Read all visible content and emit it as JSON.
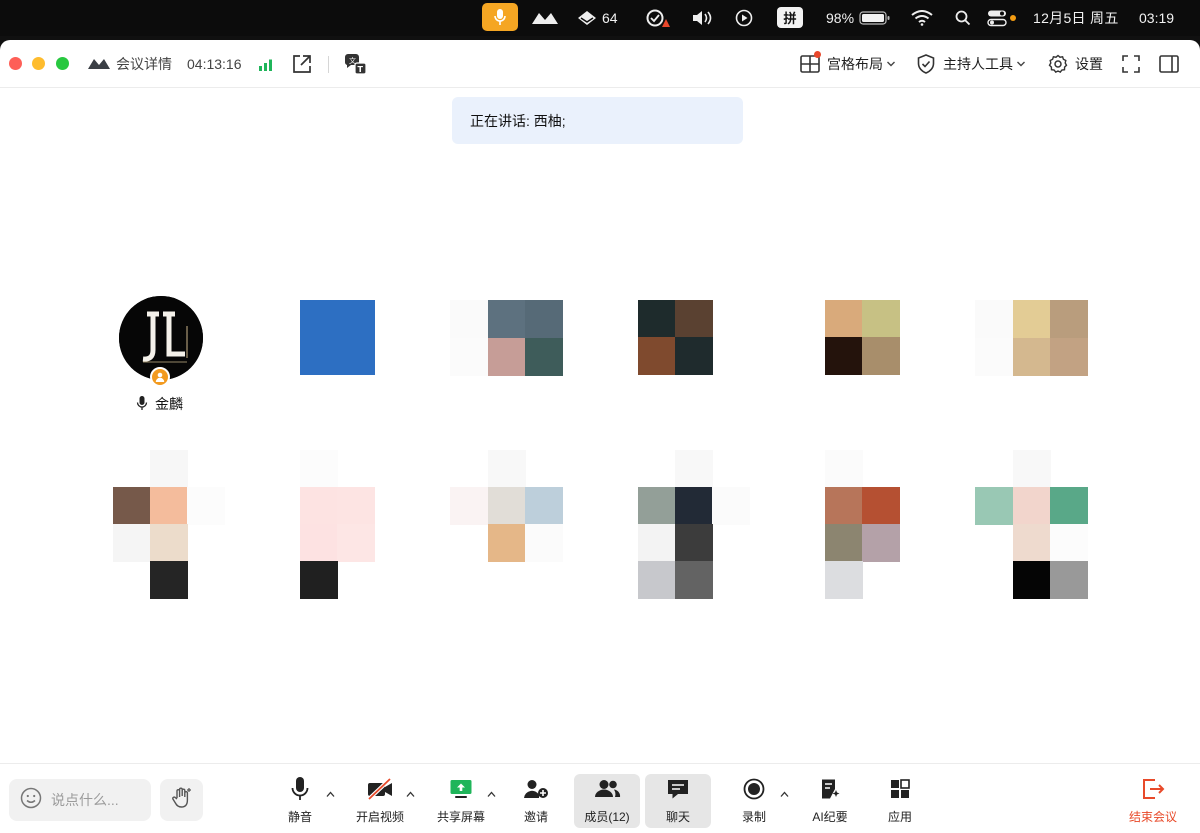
{
  "menubar": {
    "ime": "拼",
    "notify_count": "64",
    "battery": "98%",
    "date": "12月5日 周五",
    "time": "03:19"
  },
  "titlebar": {
    "meeting_details": "会议详情",
    "elapsed": "04:13:16",
    "layout": "宫格布局",
    "host_tools": "主持人工具",
    "settings": "设置"
  },
  "speaking": "正在讲话: 西柚;",
  "participants": [
    {
      "name": "金麟",
      "role": "host",
      "avatar_initials": "JL"
    }
  ],
  "chat": {
    "placeholder": "说点什么..."
  },
  "toolbar": {
    "mute": "静音",
    "video": "开启视频",
    "share": "共享屏幕",
    "invite": "邀请",
    "members": "成员(12)",
    "chat": "聊天",
    "record": "录制",
    "ai_minutes": "AI纪要",
    "apps": "应用",
    "end": "结束会议"
  },
  "colors": {
    "accent_orange": "#f5a623",
    "end_red": "#e84a2a",
    "signal_green": "#1fb55a",
    "speaking_bg": "#eaf1fc"
  }
}
